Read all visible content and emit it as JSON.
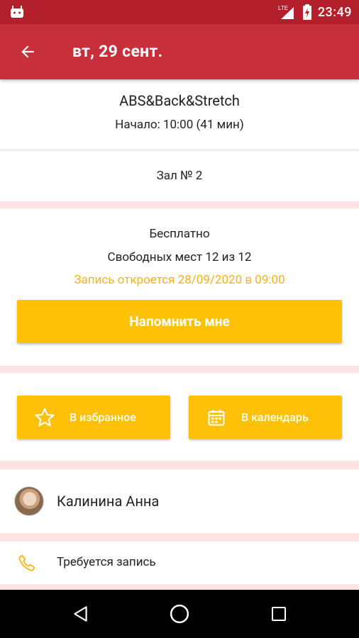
{
  "status_bar": {
    "time": "23:49",
    "network": "LTE",
    "colors": {
      "bg": "#b31f2a"
    }
  },
  "app_bar": {
    "title": "вт, 29 сент.",
    "back_icon": "arrow-back-icon",
    "colors": {
      "bg": "#c7303b"
    }
  },
  "class_info": {
    "name": "ABS&Back&Stretch",
    "start": "Начало: 10:00 (41 мин)"
  },
  "location": {
    "hall": "Зал № 2"
  },
  "booking": {
    "price": "Бесплатно",
    "seats": "Свободных мест 12 из 12",
    "opens_notice": "Запись откроется 28/09/2020 в 09:00",
    "remind_label": "Напомнить мне"
  },
  "actions": {
    "favorite_label": "В избранное",
    "favorite_icon": "star-outline-icon",
    "calendar_label": "В календарь",
    "calendar_icon": "calendar-icon"
  },
  "trainer": {
    "name": "Калинина Анна"
  },
  "note": {
    "text": "Требуется запись",
    "icon": "phone-icon"
  },
  "nav_bar": {
    "back_icon": "triangle-back-icon",
    "home_icon": "circle-home-icon",
    "recents_icon": "square-recents-icon"
  },
  "colors": {
    "accent": "#ffc107",
    "notice": "#f5b41c",
    "divider": "#fde3e3"
  }
}
